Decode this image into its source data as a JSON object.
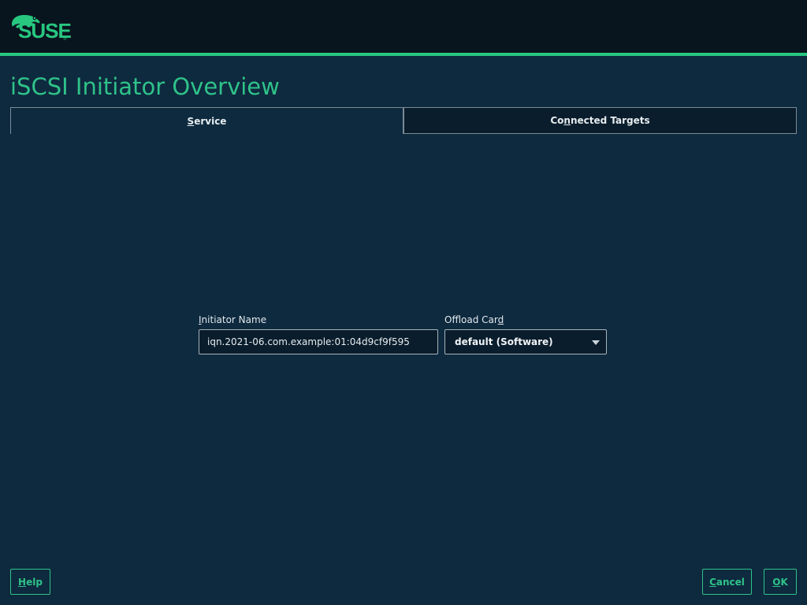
{
  "brand": {
    "name": "SUSE",
    "color": "#27c780"
  },
  "page": {
    "title": "iSCSI Initiator Overview"
  },
  "tabs": [
    {
      "mnemonic": "S",
      "rest": "ervice",
      "selected": true
    },
    {
      "pre": "Co",
      "mnemonic": "n",
      "rest": "nected Targets",
      "selected": false
    }
  ],
  "form": {
    "initiator_name": {
      "label_mnemonic": "I",
      "label_rest": "nitiator Name",
      "value": "iqn.2021-06.com.example:01:04d9cf9f595"
    },
    "offload_card": {
      "label_pre": "Offload Car",
      "label_mnemonic": "d",
      "value": "default (Software)"
    }
  },
  "buttons": {
    "help": {
      "mnemonic": "H",
      "rest": "elp"
    },
    "cancel": {
      "mnemonic": "C",
      "rest": "ancel"
    },
    "ok": {
      "mnemonic": "O",
      "rest": "K"
    }
  }
}
